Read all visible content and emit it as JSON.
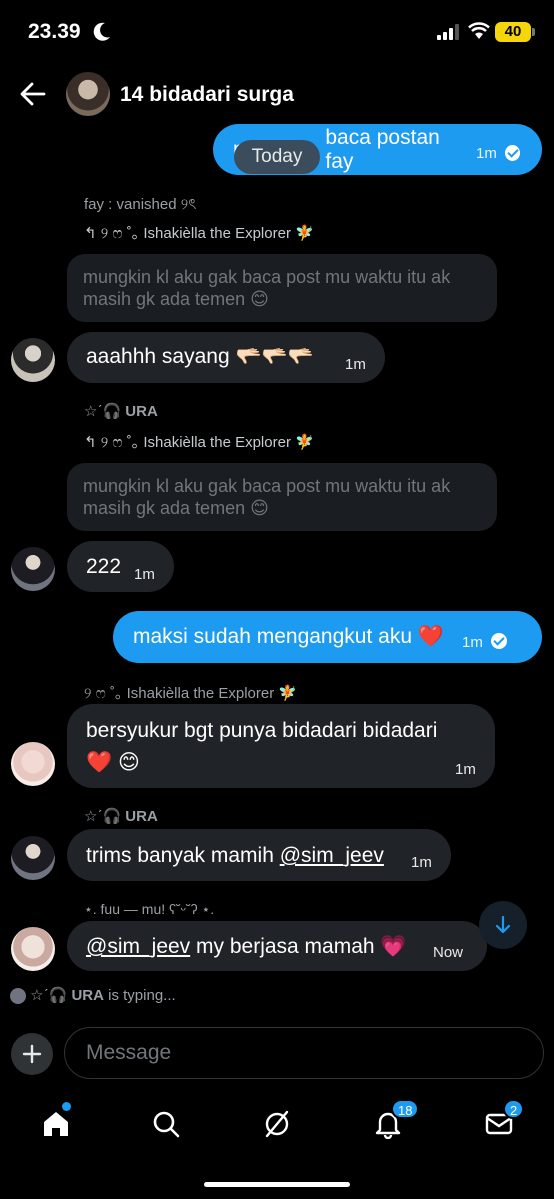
{
  "status_bar": {
    "time": "23.39",
    "battery": "40"
  },
  "header": {
    "title": "14 bidadari surga"
  },
  "date_pill": "Today",
  "messages": {
    "m1": {
      "text_visible_end": "baca postan fay",
      "text_visible_start": "m",
      "time": "1m"
    },
    "m2_meta": "fay : vanished ୨ৎ",
    "m2_reply": "↰ ୨ ෆ ˚｡ Ishakièlla the Explorer 🧚",
    "m2_quote": "mungkin kl aku gak baca post mu waktu itu ak masih gk ada temen 😊",
    "m2_text": "aaahhh sayang 🫳🏻🫳🏻🫳🏻",
    "m2_time": "1m",
    "m3_meta_prefix": "☆ˊ🎧",
    "m3_meta_name": "URA",
    "m3_reply": "↰ ୨ ෆ ˚｡ Ishakièlla the Explorer 🧚",
    "m3_quote": "mungkin kl aku gak baca post mu waktu itu ak masih gk ada temen 😊",
    "m3_text": "222",
    "m3_time": "1m",
    "m4_text": "maksi sudah mengangkut aku ❤️",
    "m4_time": "1m",
    "m5_meta": "୨ ෆ ˚｡ Ishakièlla the Explorer 🧚",
    "m5_text_line1": "bersyukur bgt punya bidadari bidadari",
    "m5_text_line2": "❤️ 😊",
    "m5_time": "1m",
    "m6_meta_prefix": "☆ˊ🎧",
    "m6_meta_name": "URA",
    "m6_text": "trims banyak mamih ",
    "m6_mention": "@sim_jeev",
    "m6_time": "1m",
    "m7_meta": "⋆. fuu — mu! ʕ˘ᵕ˘ʔ ⋆.",
    "m7_mention": "@sim_jeev",
    "m7_text": " my berjasa mamah 💗",
    "m7_time": "Now"
  },
  "typing": {
    "prefix": "☆ˊ🎧",
    "name": "URA",
    "suffix": "is typing..."
  },
  "composer": {
    "placeholder": "Message"
  },
  "tabbar": {
    "notifications_badge": "18",
    "messages_badge": "2"
  },
  "colors": {
    "accent": "#1d9bf0",
    "incoming_bubble": "#202327",
    "background": "#000000"
  }
}
